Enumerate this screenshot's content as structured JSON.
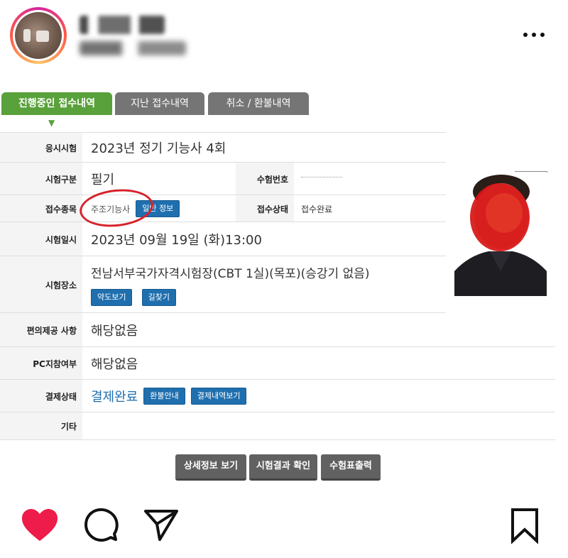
{
  "tabs": [
    {
      "label": "진행중인 접수내역",
      "active": true
    },
    {
      "label": "지난 접수내역",
      "active": false
    },
    {
      "label": "취소 / 환불내역",
      "active": false
    }
  ],
  "rows": {
    "exam": {
      "label": "응시시험",
      "value": "2023년 정기 기능사 4회"
    },
    "exam_type": {
      "label": "시험구분",
      "value": "필기"
    },
    "exam_no_label": "수험번호",
    "category": {
      "label": "접수종목",
      "value": "주조기능사",
      "button": "일반 정보"
    },
    "reg_status": {
      "label": "접수상태",
      "value": "접수완료"
    },
    "date": {
      "label": "시험일시",
      "value": "2023년 09월 19일 (화)13:00"
    },
    "venue": {
      "label": "시험장소",
      "value": "전남서부국가자격시험장(CBT 1실)(목포)(승강기 없음)",
      "buttons": [
        "약도보기",
        "길찾기"
      ]
    },
    "convenience": {
      "label": "편의제공 사항",
      "value": "해당없음"
    },
    "pc": {
      "label": "PC지참여부",
      "value": "해당없음"
    },
    "payment": {
      "label": "결제상태",
      "value": "결제완료",
      "buttons": [
        "환불안내",
        "결제내역보기"
      ]
    },
    "etc": {
      "label": "기타",
      "value": ""
    }
  },
  "bottom_buttons": [
    "상세정보 보기",
    "시험결과 확인",
    "수험표출력"
  ],
  "colors": {
    "tab_active": "#59a13a",
    "tab_inactive": "#757575",
    "button_blue": "#1f6fae",
    "button_gray": "#616161",
    "annotation": "#d8212a",
    "like": "#ed1c4a"
  },
  "icons": {
    "more": "more-horizontal-icon",
    "like": "heart-filled-icon",
    "comment": "comment-icon",
    "share": "send-icon",
    "save": "bookmark-icon"
  }
}
